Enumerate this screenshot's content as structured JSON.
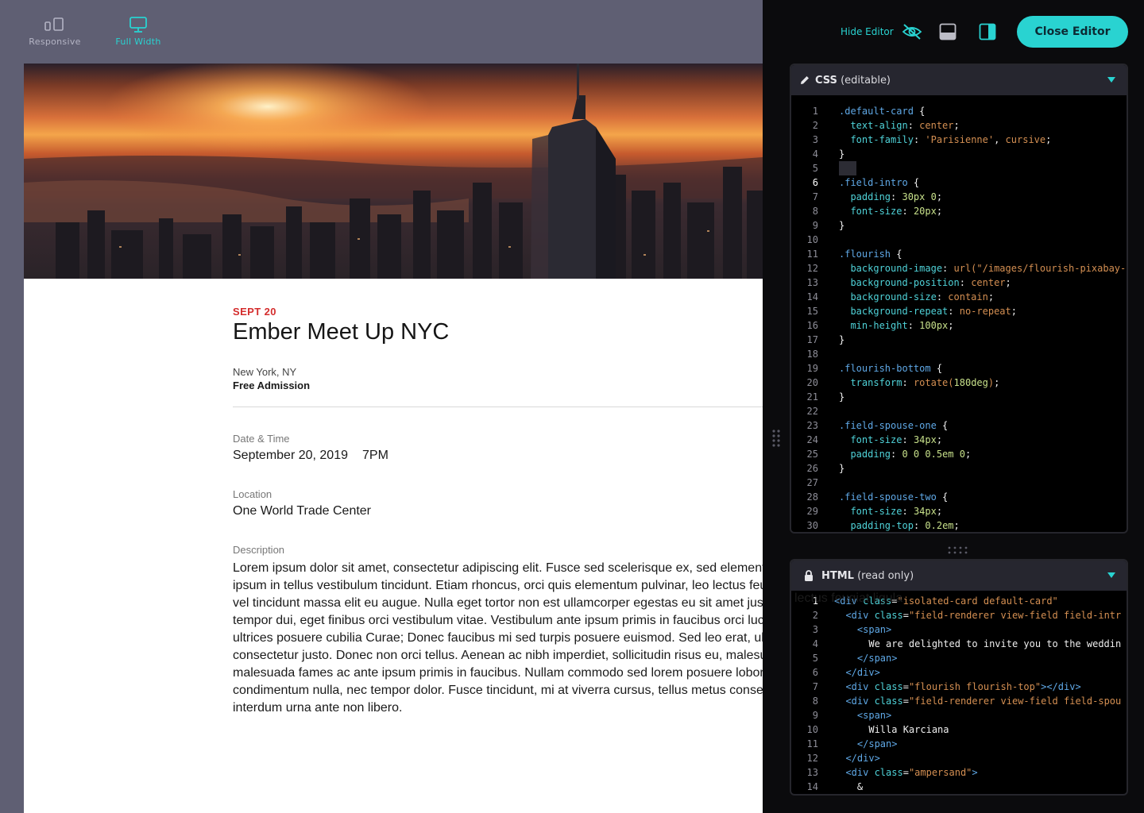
{
  "toolbar": {
    "responsive_label": "Responsive",
    "full_width_label": "Full Width",
    "responsive_icon": "devices-icon",
    "full_width_icon": "monitor-icon"
  },
  "event": {
    "date_tag": "SEPT 20",
    "title": "Ember Meet Up NYC",
    "city": "New York, NY",
    "admission": "Free Admission",
    "datetime_label": "Date & Time",
    "date": "September 20, 2019",
    "time": "7PM",
    "location_label": "Location",
    "location": "One World Trade Center",
    "description_label": "Description",
    "description": "Lorem ipsum dolor sit amet, consectetur adipiscing elit. Fusce sed scelerisque ex, sed elementum sit amet ipsum in tellus vestibulum tincidunt. Etiam rhoncus, orci quis elementum pulvinar, leo lectus feugiat ligula vel tincidunt massa elit eu augue. Nulla eget tortor non est ullamcorper egestas eu sit amet justo. Integer tempor dui, eget finibus orci vestibulum vitae. Vestibulum ante ipsum primis in faucibus orci luctus et ultrices posuere cubilia Curae; Donec faucibus mi sed turpis posuere euismod. Sed leo erat, ultricies non consectetur justo. Donec non orci tellus. Aenean ac nibh imperdiet, sollicitudin risus eu, malesuada et malesuada fames ac ante ipsum primis in faucibus. Nullam commodo sed lorem posuere lobortis condimentum nulla, nec tempor dolor. Fusce tincidunt, mi at viverra cursus, tellus metus consequat interdum urna ante non libero.",
    "ghost_overlay": "lectus feugiat ligula"
  },
  "editor": {
    "hide_editor_label": "Hide Editor",
    "close_editor_label": "Close Editor",
    "css_pane": {
      "title_bold": "CSS",
      "title_suffix": "(editable)",
      "active_line": 6,
      "lines": [
        [
          [
            "sel",
            ".default-card"
          ],
          [
            "br",
            " {"
          ]
        ],
        [
          [
            "plain",
            "  "
          ],
          [
            "prop",
            "text-align"
          ],
          [
            "plain",
            ": "
          ],
          [
            "val",
            "center"
          ],
          [
            "plain",
            ";"
          ]
        ],
        [
          [
            "plain",
            "  "
          ],
          [
            "prop",
            "font-family"
          ],
          [
            "plain",
            ": "
          ],
          [
            "val",
            "'Parisienne'"
          ],
          [
            "plain",
            ", "
          ],
          [
            "val",
            "cursive"
          ],
          [
            "plain",
            ";"
          ]
        ],
        [
          [
            "br",
            "}"
          ]
        ],
        [
          [
            "cursor",
            ""
          ]
        ],
        [
          [
            "sel",
            ".field-intro"
          ],
          [
            "br",
            " {"
          ]
        ],
        [
          [
            "plain",
            "  "
          ],
          [
            "prop",
            "padding"
          ],
          [
            "plain",
            ": "
          ],
          [
            "num-v",
            "30px 0"
          ],
          [
            "plain",
            ";"
          ]
        ],
        [
          [
            "plain",
            "  "
          ],
          [
            "prop",
            "font-size"
          ],
          [
            "plain",
            ": "
          ],
          [
            "num-v",
            "20px"
          ],
          [
            "plain",
            ";"
          ]
        ],
        [
          [
            "br",
            "}"
          ]
        ],
        [],
        [
          [
            "sel",
            ".flourish"
          ],
          [
            "br",
            " {"
          ]
        ],
        [
          [
            "plain",
            "  "
          ],
          [
            "prop",
            "background-image"
          ],
          [
            "plain",
            ": "
          ],
          [
            "val",
            "url(\"/images/flourish-pixabay-"
          ]
        ],
        [
          [
            "plain",
            "  "
          ],
          [
            "prop",
            "background-position"
          ],
          [
            "plain",
            ": "
          ],
          [
            "val",
            "center"
          ],
          [
            "plain",
            ";"
          ]
        ],
        [
          [
            "plain",
            "  "
          ],
          [
            "prop",
            "background-size"
          ],
          [
            "plain",
            ": "
          ],
          [
            "val",
            "contain"
          ],
          [
            "plain",
            ";"
          ]
        ],
        [
          [
            "plain",
            "  "
          ],
          [
            "prop",
            "background-repeat"
          ],
          [
            "plain",
            ": "
          ],
          [
            "val",
            "no-repeat"
          ],
          [
            "plain",
            ";"
          ]
        ],
        [
          [
            "plain",
            "  "
          ],
          [
            "prop",
            "min-height"
          ],
          [
            "plain",
            ": "
          ],
          [
            "num-v",
            "100px"
          ],
          [
            "plain",
            ";"
          ]
        ],
        [
          [
            "br",
            "}"
          ]
        ],
        [],
        [
          [
            "sel",
            ".flourish-bottom"
          ],
          [
            "br",
            " {"
          ]
        ],
        [
          [
            "plain",
            "  "
          ],
          [
            "prop",
            "transform"
          ],
          [
            "plain",
            ": "
          ],
          [
            "val",
            "rotate("
          ],
          [
            "num-v",
            "180deg"
          ],
          [
            "val",
            ")"
          ],
          [
            "plain",
            ";"
          ]
        ],
        [
          [
            "br",
            "}"
          ]
        ],
        [],
        [
          [
            "sel",
            ".field-spouse-one"
          ],
          [
            "br",
            " {"
          ]
        ],
        [
          [
            "plain",
            "  "
          ],
          [
            "prop",
            "font-size"
          ],
          [
            "plain",
            ": "
          ],
          [
            "num-v",
            "34px"
          ],
          [
            "plain",
            ";"
          ]
        ],
        [
          [
            "plain",
            "  "
          ],
          [
            "prop",
            "padding"
          ],
          [
            "plain",
            ": "
          ],
          [
            "num-v",
            "0 0 0.5em 0"
          ],
          [
            "plain",
            ";"
          ]
        ],
        [
          [
            "br",
            "}"
          ]
        ],
        [],
        [
          [
            "sel",
            ".field-spouse-two"
          ],
          [
            "br",
            " {"
          ]
        ],
        [
          [
            "plain",
            "  "
          ],
          [
            "prop",
            "font-size"
          ],
          [
            "plain",
            ": "
          ],
          [
            "num-v",
            "34px"
          ],
          [
            "plain",
            ";"
          ]
        ],
        [
          [
            "plain",
            "  "
          ],
          [
            "prop",
            "padding-top"
          ],
          [
            "plain",
            ": "
          ],
          [
            "num-v",
            "0.2em"
          ],
          [
            "plain",
            ";"
          ]
        ]
      ]
    },
    "html_pane": {
      "title_bold": "HTML",
      "title_suffix": "(read only)",
      "active_line": 1,
      "lines": [
        [
          [
            "tag",
            "<div "
          ],
          [
            "attr",
            "class"
          ],
          [
            "plain",
            "="
          ],
          [
            "str",
            "\"isolated-card default-card\""
          ]
        ],
        [
          [
            "plain",
            "  "
          ],
          [
            "tag",
            "<div "
          ],
          [
            "attr",
            "class"
          ],
          [
            "plain",
            "="
          ],
          [
            "str",
            "\"field-renderer view-field field-intr"
          ]
        ],
        [
          [
            "plain",
            "    "
          ],
          [
            "tag",
            "<span>"
          ]
        ],
        [
          [
            "plain",
            "      We are delighted to invite you to the weddin"
          ]
        ],
        [
          [
            "plain",
            "    "
          ],
          [
            "tag",
            "</span>"
          ]
        ],
        [
          [
            "plain",
            "  "
          ],
          [
            "tag",
            "</div>"
          ]
        ],
        [
          [
            "plain",
            "  "
          ],
          [
            "tag",
            "<div "
          ],
          [
            "attr",
            "class"
          ],
          [
            "plain",
            "="
          ],
          [
            "str",
            "\"flourish flourish-top\""
          ],
          [
            "tag",
            "></div>"
          ]
        ],
        [
          [
            "plain",
            "  "
          ],
          [
            "tag",
            "<div "
          ],
          [
            "attr",
            "class"
          ],
          [
            "plain",
            "="
          ],
          [
            "str",
            "\"field-renderer view-field field-spou"
          ]
        ],
        [
          [
            "plain",
            "    "
          ],
          [
            "tag",
            "<span>"
          ]
        ],
        [
          [
            "plain",
            "      Willa Karciana"
          ]
        ],
        [
          [
            "plain",
            "    "
          ],
          [
            "tag",
            "</span>"
          ]
        ],
        [
          [
            "plain",
            "  "
          ],
          [
            "tag",
            "</div>"
          ]
        ],
        [
          [
            "plain",
            "  "
          ],
          [
            "tag",
            "<div "
          ],
          [
            "attr",
            "class"
          ],
          [
            "plain",
            "="
          ],
          [
            "str",
            "\"ampersand\""
          ],
          [
            "tag",
            ">"
          ]
        ],
        [
          [
            "plain",
            "    &"
          ]
        ]
      ]
    }
  }
}
